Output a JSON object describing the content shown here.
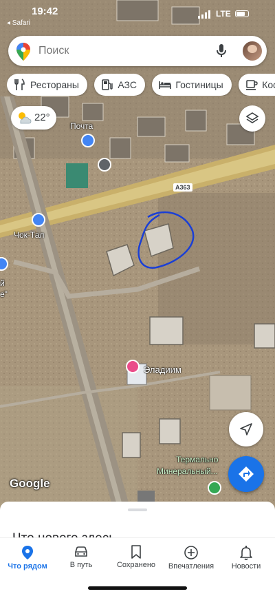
{
  "status_bar": {
    "time": "19:42",
    "back_app": "◂ Safari",
    "network": "LTE"
  },
  "search": {
    "placeholder": "Поиск"
  },
  "chips": [
    {
      "label": "Рестораны",
      "icon": "fork-knife-icon"
    },
    {
      "label": "АЗС",
      "icon": "gas-station-icon"
    },
    {
      "label": "Гостиницы",
      "icon": "bed-icon"
    },
    {
      "label": "Кофейн",
      "icon": "coffee-icon"
    }
  ],
  "weather": {
    "temperature": "22°",
    "icon": "partly-cloudy-icon"
  },
  "map": {
    "labels": {
      "post": "Почта",
      "road": "А363",
      "place1": "Чок-Тал",
      "place2": "Эладиим",
      "place3_line1": "Термально",
      "place3_line2": "Минеральный...",
      "left_edge1": "й",
      "left_edge2": "e\""
    },
    "attribution": "Google"
  },
  "sheet": {
    "peek_title": "Что нового здесь"
  },
  "tabs": [
    {
      "label": "Что рядом",
      "icon": "location-pin-icon",
      "active": true
    },
    {
      "label": "В путь",
      "icon": "car-icon",
      "active": false
    },
    {
      "label": "Сохранено",
      "icon": "bookmark-icon",
      "active": false
    },
    {
      "label": "Впечатления",
      "icon": "add-circle-icon",
      "active": false
    },
    {
      "label": "Новости",
      "icon": "bell-icon",
      "active": false
    }
  ],
  "colors": {
    "accent": "#1a73e8",
    "poi_red": "#ea4c89",
    "poi_blue": "#4285f4",
    "poi_green": "#34a853",
    "road": "#e8c45a"
  }
}
